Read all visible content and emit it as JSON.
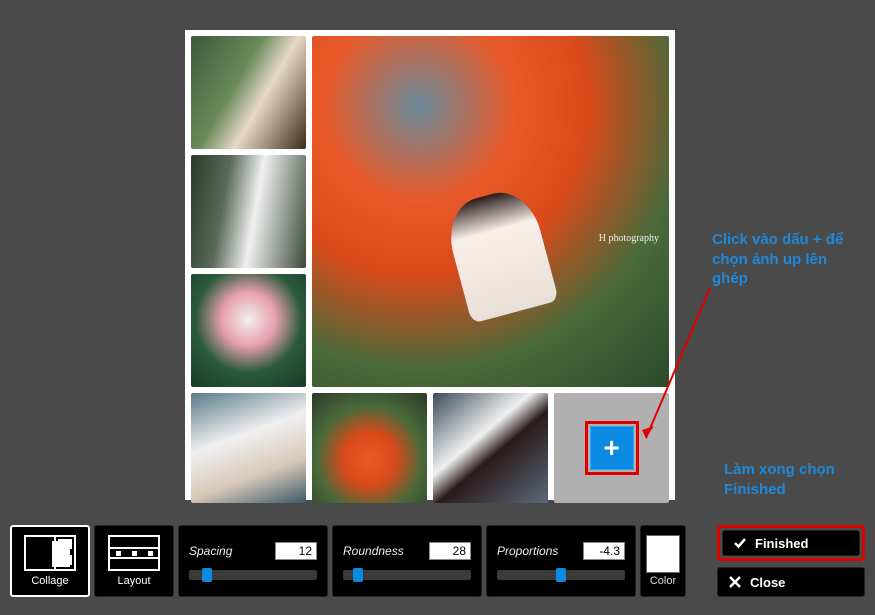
{
  "collage": {
    "watermark": "H  photography",
    "add_button_label": "+"
  },
  "toolbar": {
    "modes": {
      "collage": "Collage",
      "layout": "Layout"
    },
    "spacing": {
      "label": "Spacing",
      "value": "12",
      "thumb_pct": 10
    },
    "roundness": {
      "label": "Roundness",
      "value": "28",
      "thumb_pct": 8
    },
    "proportions": {
      "label": "Proportions",
      "value": "-4.3",
      "thumb_pct": 46
    },
    "color": {
      "label": "Color",
      "swatch": "#ffffff"
    }
  },
  "actions": {
    "finished": "Finished",
    "close": "Close"
  },
  "annotations": {
    "tip_add": "Click vào dấu + để chọn ảnh up lên ghép",
    "tip_finished": "Làm xong chọn Finished"
  }
}
